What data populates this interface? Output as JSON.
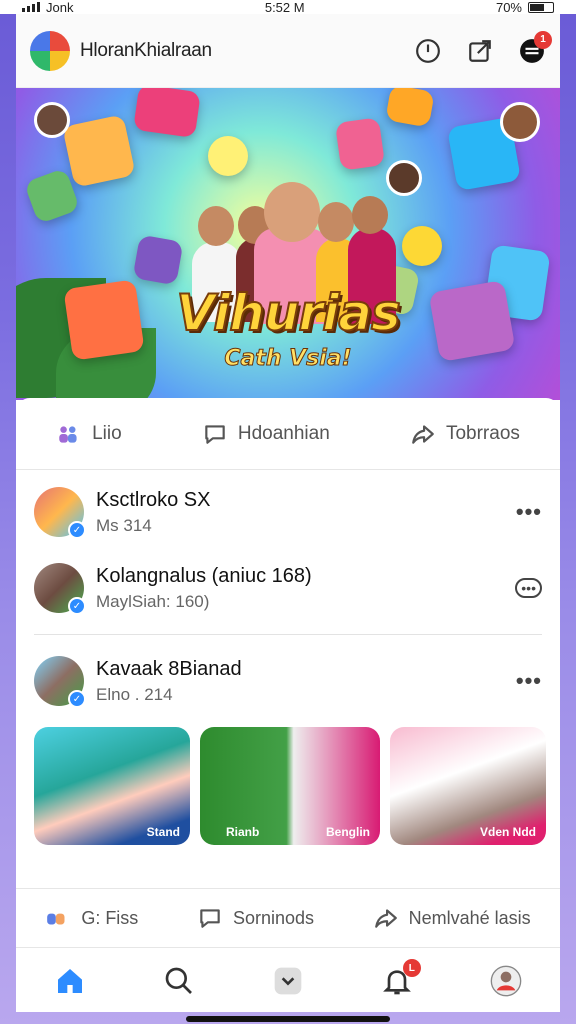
{
  "status": {
    "carrier": "Jonk",
    "time": "5:52 M",
    "battery": "70%"
  },
  "header": {
    "app_title": "HloranKhialraan",
    "notification_count": "1"
  },
  "banner": {
    "title": "Vihurias",
    "subtitle": "Cath Vsia!"
  },
  "actions_top": [
    {
      "label": "Liio",
      "icon": "people-icon"
    },
    {
      "label": "Hdoanhian",
      "icon": "comment-icon"
    },
    {
      "label": "Tobrraos",
      "icon": "share-icon"
    }
  ],
  "feed": [
    {
      "name": "Ksctlroko SX",
      "sub": "Ms 314"
    },
    {
      "name": "Kolangnalus (aniuc 168)",
      "sub": "MaylSiah: 160)"
    },
    {
      "name": "Kavaak 8Bianad",
      "sub": "Elno . 214"
    }
  ],
  "thumbnails": [
    {
      "label": "Stand",
      "color": "#1f4fa0"
    },
    {
      "label": "Rianb",
      "color": "#2e8b2e"
    },
    {
      "label": "Benglin",
      "color": "#d81b73"
    },
    {
      "label": "Vden Ndd",
      "color": "#e0206e"
    }
  ],
  "actions_bottom": [
    {
      "label": "G: Fiss",
      "icon": "people-icon"
    },
    {
      "label": "Sorninods",
      "icon": "comment-icon"
    },
    {
      "label": "Nemlvahé lasis",
      "icon": "share-icon"
    }
  ],
  "tabbar": {
    "notification_count": "L"
  },
  "colors": {
    "accent": "#2d8cff",
    "badge": "#e53935",
    "title_yellow": "#ffd43b"
  }
}
